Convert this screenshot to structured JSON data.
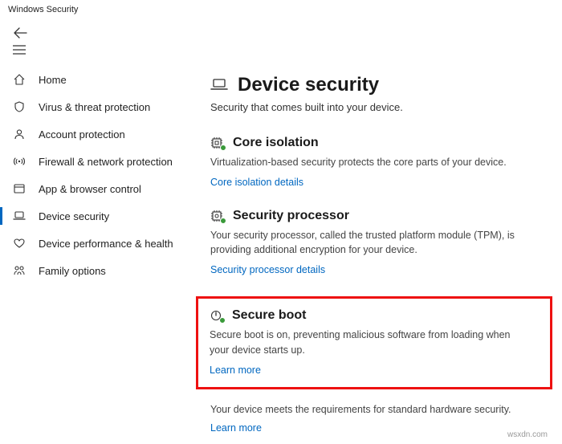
{
  "titlebar": {
    "title": "Windows Security"
  },
  "sidebar": {
    "items": [
      {
        "label": "Home"
      },
      {
        "label": "Virus & threat protection"
      },
      {
        "label": "Account protection"
      },
      {
        "label": "Firewall & network protection"
      },
      {
        "label": "App & browser control"
      },
      {
        "label": "Device security"
      },
      {
        "label": "Device performance & health"
      },
      {
        "label": "Family options"
      }
    ]
  },
  "page": {
    "title": "Device security",
    "subtitle": "Security that comes built into your device."
  },
  "sections": {
    "core_isolation": {
      "title": "Core isolation",
      "body": "Virtualization-based security protects the core parts of your device.",
      "link": "Core isolation details"
    },
    "security_processor": {
      "title": "Security processor",
      "body": "Your security processor, called the trusted platform module (TPM), is providing additional encryption for your device.",
      "link": "Security processor details"
    },
    "secure_boot": {
      "title": "Secure boot",
      "body": "Secure boot is on, preventing malicious software from loading when your device starts up.",
      "link": "Learn more"
    }
  },
  "footer": {
    "status": "Your device meets the requirements for standard hardware security.",
    "link": "Learn more"
  },
  "watermark": "wsxdn.com"
}
